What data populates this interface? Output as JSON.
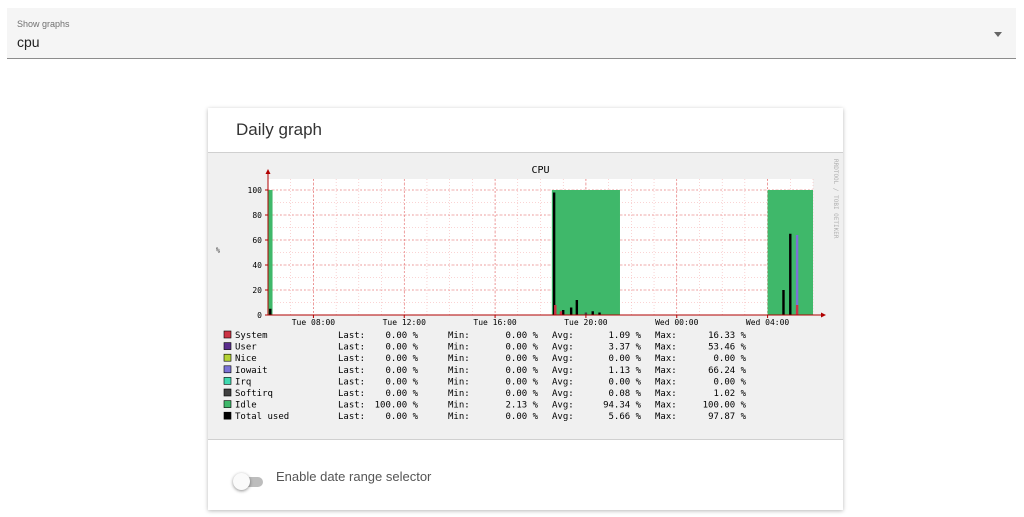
{
  "selector": {
    "label": "Show graphs",
    "value": "cpu"
  },
  "card": {
    "title": "Daily graph"
  },
  "toggle": {
    "label": "Enable date range selector",
    "checked": false
  },
  "chart_data": {
    "type": "area",
    "title": "CPU",
    "ylabel": "%",
    "watermark": "RRDTOOL / TOBI OETIKER",
    "ylim": [
      0,
      100
    ],
    "yticks": [
      "0",
      "20",
      "40",
      "60",
      "80",
      "100"
    ],
    "xticks": [
      "Tue 08:00",
      "Tue 12:00",
      "Tue 16:00",
      "Tue 20:00",
      "Wed 00:00",
      "Wed 04:00"
    ],
    "xrange_hours": [
      6.0,
      30.0
    ],
    "xtick_hours": [
      8,
      12,
      16,
      20,
      24,
      28
    ],
    "colors": {
      "System": "#cc3344",
      "User": "#5a2d8c",
      "Nice": "#b5d335",
      "Iowait": "#7b72d6",
      "Irq": "#3fd9b0",
      "Softirq": "#404040",
      "Idle": "#3fb86a",
      "Total used": "#000000",
      "axis": "#b00000",
      "grid": "#f4a8a8"
    },
    "idle_blocks": [
      {
        "start": 6.0,
        "end": 6.2,
        "value": 100
      },
      {
        "start": 18.5,
        "end": 21.5,
        "value": 100
      },
      {
        "start": 28.0,
        "end": 30.0,
        "value": 100
      }
    ],
    "spikes": [
      {
        "series": "Total used",
        "x": 18.6,
        "value": 98
      },
      {
        "series": "System",
        "x": 18.65,
        "value": 8
      },
      {
        "series": "Total used",
        "x": 19.0,
        "value": 4
      },
      {
        "series": "System",
        "x": 18.9,
        "value": 3
      },
      {
        "series": "Total used",
        "x": 19.35,
        "value": 6
      },
      {
        "series": "Total used",
        "x": 19.6,
        "value": 12
      },
      {
        "series": "Softirq",
        "x": 20.0,
        "value": 2
      },
      {
        "series": "Total used",
        "x": 20.3,
        "value": 3
      },
      {
        "series": "Total used",
        "x": 20.6,
        "value": 2
      },
      {
        "series": "Total used",
        "x": 28.7,
        "value": 20
      },
      {
        "series": "Total used",
        "x": 29.0,
        "value": 65
      },
      {
        "series": "Iowait",
        "x": 29.3,
        "value": 64
      },
      {
        "series": "System",
        "x": 29.3,
        "value": 8
      },
      {
        "series": "Total used",
        "x": 6.1,
        "value": 5
      }
    ],
    "legend": [
      {
        "name": "System",
        "last": "0.00 %",
        "min": "0.00 %",
        "avg": "1.09 %",
        "max": "16.33 %"
      },
      {
        "name": "User",
        "last": "0.00 %",
        "min": "0.00 %",
        "avg": "3.37 %",
        "max": "53.46 %"
      },
      {
        "name": "Nice",
        "last": "0.00 %",
        "min": "0.00 %",
        "avg": "0.00 %",
        "max": "0.00 %"
      },
      {
        "name": "Iowait",
        "last": "0.00 %",
        "min": "0.00 %",
        "avg": "1.13 %",
        "max": "66.24 %"
      },
      {
        "name": "Irq",
        "last": "0.00 %",
        "min": "0.00 %",
        "avg": "0.00 %",
        "max": "0.00 %"
      },
      {
        "name": "Softirq",
        "last": "0.00 %",
        "min": "0.00 %",
        "avg": "0.08 %",
        "max": "1.02 %"
      },
      {
        "name": "Idle",
        "last": "100.00 %",
        "min": "2.13 %",
        "avg": "94.34 %",
        "max": "100.00 %"
      },
      {
        "name": "Total used",
        "last": "0.00 %",
        "min": "0.00 %",
        "avg": "5.66 %",
        "max": "97.87 %"
      }
    ],
    "stat_labels": {
      "last": "Last:",
      "min": "Min:",
      "avg": "Avg:",
      "max": "Max:"
    }
  }
}
